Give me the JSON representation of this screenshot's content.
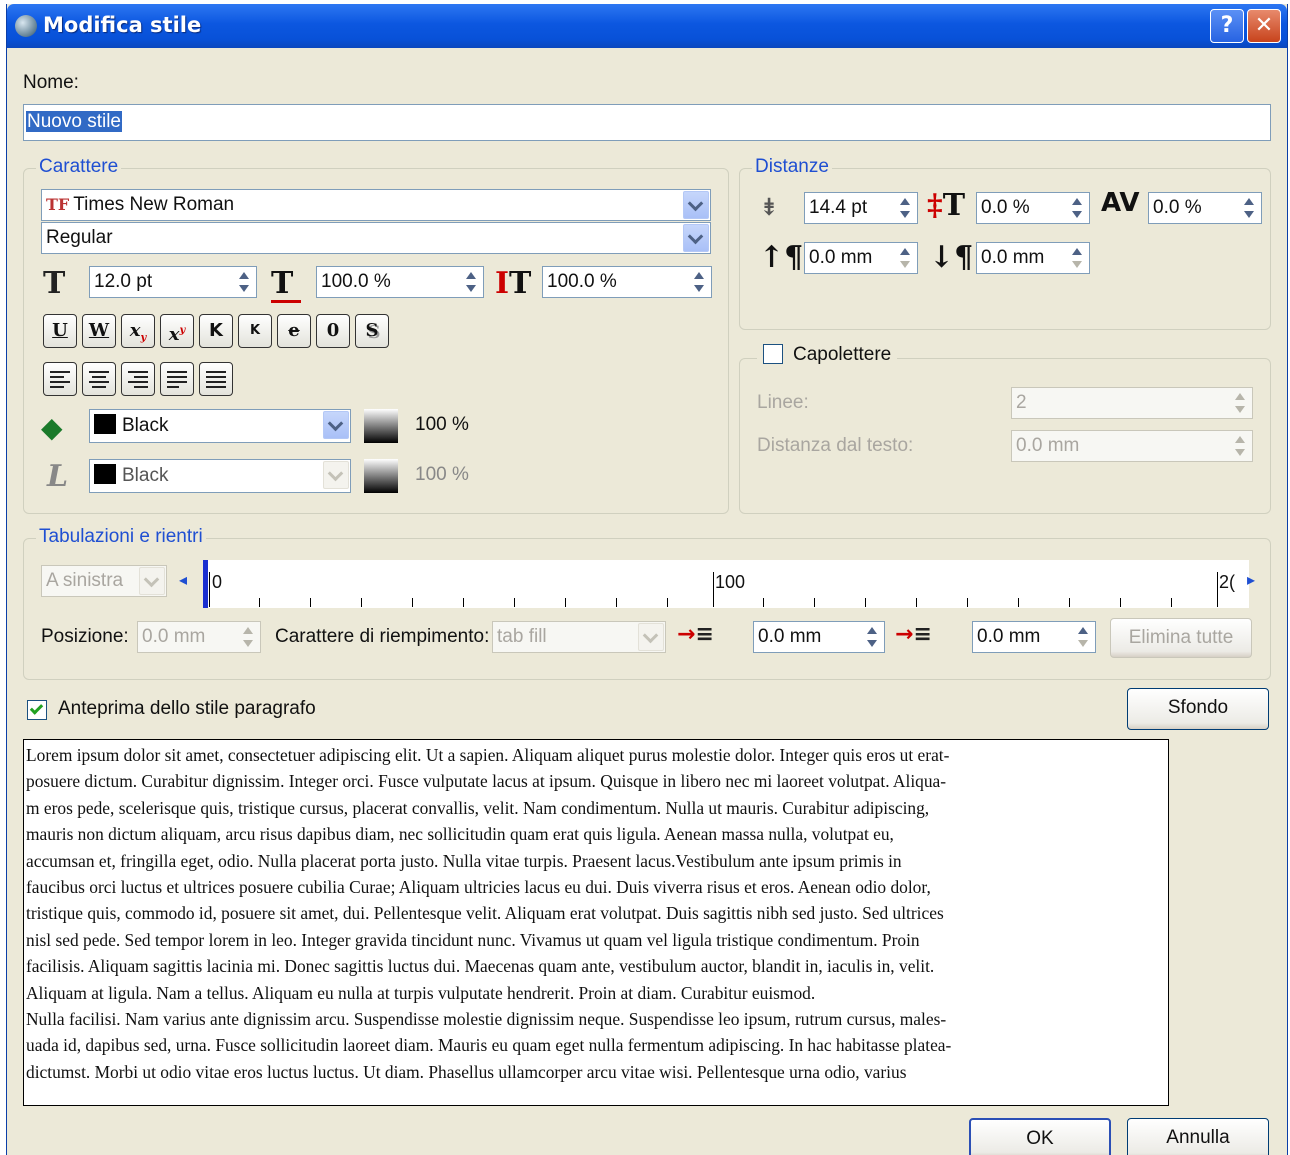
{
  "window": {
    "title": "Modifica stile",
    "help_label": "?",
    "close_label": "✕"
  },
  "name": {
    "label": "Nome:",
    "value": "Nuovo stile"
  },
  "character": {
    "group_title": "Carattere",
    "font_family": "Times New Roman",
    "font_style": "Regular",
    "font_size": "12.0 pt",
    "horizontal_scale": "100.0 %",
    "vertical_scale": "100.0 %",
    "style_buttons": [
      "U",
      "W",
      "x",
      "x",
      "K",
      "K",
      "e",
      "0",
      "S"
    ],
    "fill_color": "Black",
    "fill_shade": "100 %",
    "stroke_color": "Black",
    "stroke_shade": "100 %"
  },
  "distances": {
    "group_title": "Distanze",
    "line_spacing": "14.4 pt",
    "baseline_offset": "0.0 %",
    "tracking": "0.0 %",
    "space_above": "0.0 mm",
    "space_below": "0.0 mm"
  },
  "drop_caps": {
    "label": "Capolettere",
    "checked": false,
    "lines_label": "Linee:",
    "lines_value": "2",
    "distance_label": "Distanza dal testo:",
    "distance_value": "0.0 mm"
  },
  "tabs": {
    "group_title": "Tabulazioni e rientri",
    "alignment": "A sinistra",
    "ruler_labels": [
      "0",
      "100",
      "2("
    ],
    "position_label": "Posizione:",
    "position_value": "0.0 mm",
    "fill_char_label": "Carattere di riempimento:",
    "fill_char_value": "tab fill",
    "first_line_indent": "0.0 mm",
    "left_indent": "0.0 mm",
    "delete_all_label": "Elimina tutte"
  },
  "preview": {
    "checkbox_label": "Anteprima dello stile paragrafo",
    "checked": true,
    "background_button": "Sfondo",
    "lines": [
      "Lorem ipsum dolor sit amet, consectetuer adipiscing elit. Ut a sapien. Aliquam aliquet purus molestie dolor. Integer quis eros ut erat-",
      " posuere dictum. Curabitur dignissim. Integer orci. Fusce vulputate lacus at ipsum. Quisque in libero nec mi laoreet volutpat. Aliqua-",
      "m eros pede, scelerisque quis, tristique cursus, placerat convallis, velit. Nam condimentum. Nulla ut mauris. Curabitur adipiscing,",
      "mauris non dictum aliquam, arcu risus dapibus diam, nec sollicitudin quam erat quis ligula. Aenean massa nulla, volutpat eu,",
      "accumsan et, fringilla eget, odio. Nulla placerat porta justo. Nulla vitae turpis. Praesent lacus.Vestibulum ante ipsum primis in",
      "faucibus orci luctus et ultrices posuere cubilia Curae; Aliquam ultricies lacus eu dui. Duis viverra risus et eros. Aenean odio dolor,",
      "tristique quis, commodo id, posuere sit amet, dui. Pellentesque velit. Aliquam erat volutpat. Duis sagittis nibh sed justo. Sed ultrices",
      "nisl sed pede. Sed tempor lorem in leo. Integer gravida tincidunt nunc. Vivamus ut quam vel ligula tristique condimentum. Proin",
      "facilisis. Aliquam sagittis lacinia mi. Donec sagittis luctus dui. Maecenas quam ante, vestibulum auctor, blandit in, iaculis in, velit.",
      "Aliquam at ligula. Nam a tellus. Aliquam eu nulla at turpis vulputate hendrerit. Proin at diam. Curabitur euismod.",
      "Nulla facilisi. Nam varius ante dignissim arcu. Suspendisse molestie dignissim neque. Suspendisse leo ipsum, rutrum cursus, males-",
      "uada id, dapibus sed, urna. Fusce sollicitudin laoreet diam. Mauris eu quam eget nulla fermentum adipiscing. In hac habitasse platea-",
      " dictumst. Morbi ut odio vitae eros luctus luctus. Ut diam. Phasellus ullamcorper arcu vitae wisi. Pellentesque urna odio, varius"
    ]
  },
  "footer": {
    "ok_label": "OK",
    "cancel_label": "Annulla"
  },
  "colors": {
    "title_bar": "#0a55dc",
    "dialog_bg": "#ece9d8",
    "group_title": "#1f4fd2",
    "focus_highlight": "#316ac5"
  }
}
